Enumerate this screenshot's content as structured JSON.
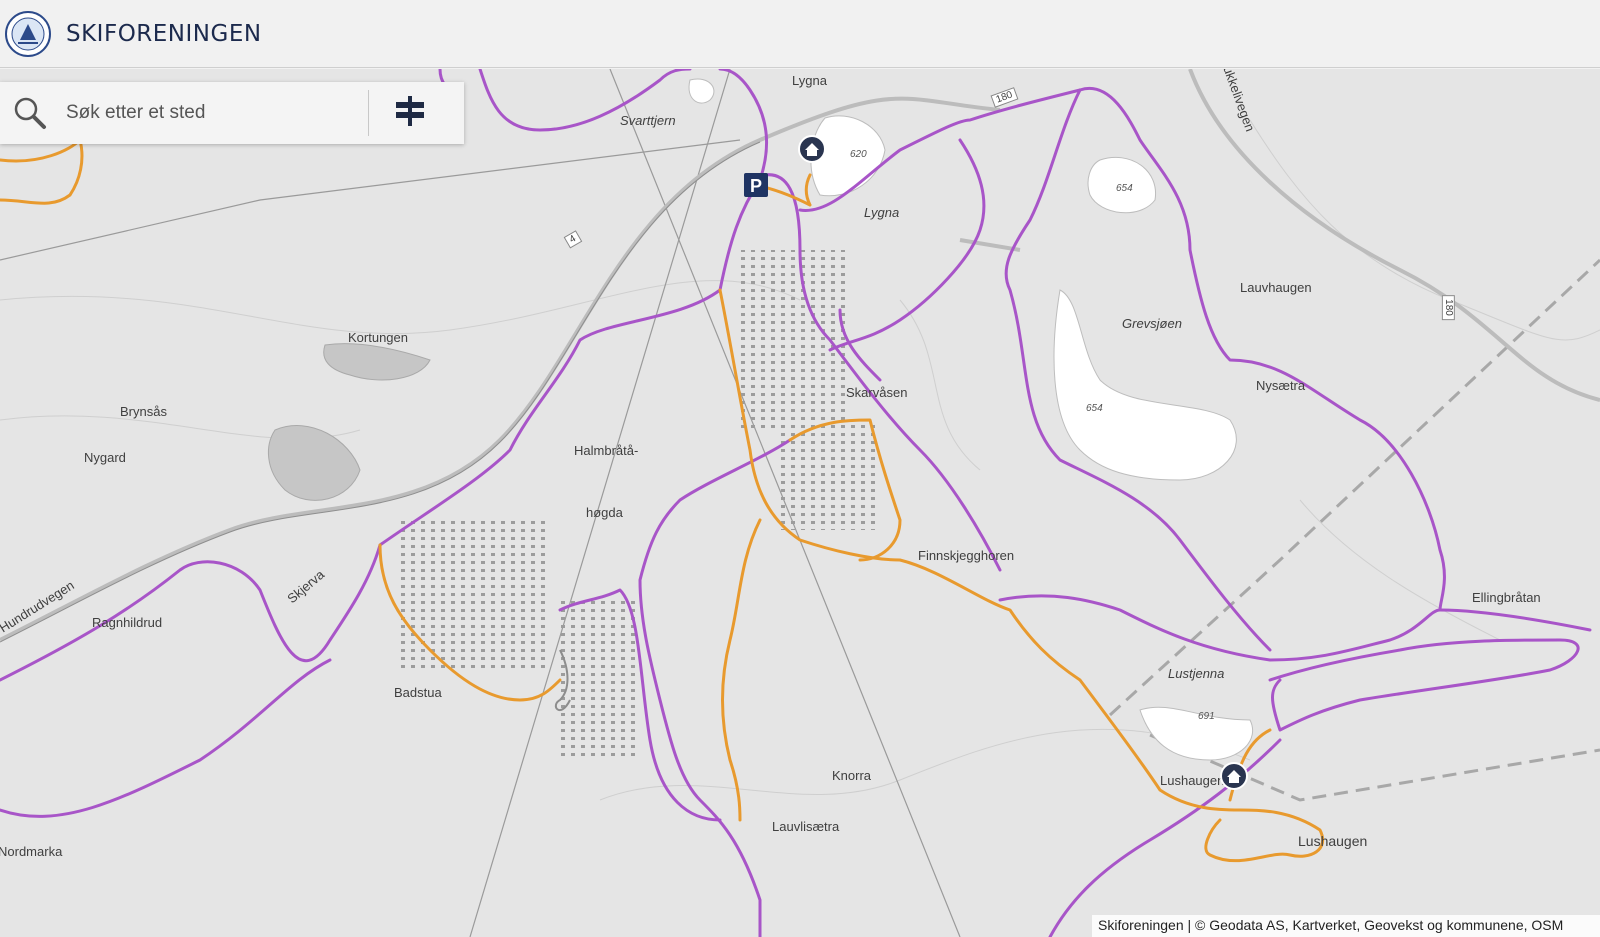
{
  "header": {
    "brand": "SKIFORENINGEN",
    "logo_icon": "skiforeningen-logo-icon"
  },
  "search": {
    "placeholder": "Søk etter et sted",
    "value": "",
    "search_icon": "magnifier-icon",
    "filter_icon": "signpost-icon"
  },
  "map": {
    "trail_colors": {
      "purple": "#a855c8",
      "orange": "#e89a2e"
    },
    "places": {
      "lygna_n": "Lygna",
      "svarttjern": "Svarttjern",
      "lygna": "Lygna",
      "lake_620": "620",
      "lake_654": "654",
      "kortungen": "Kortungen",
      "brynsas": "Brynsås",
      "nygard": "Nygard",
      "halmbrata1": "Halmbråtå-",
      "halmbrata2": "høgda",
      "skarvasen": "Skarvåsen",
      "grevsjoen": "Grevsjøen",
      "lake_654b": "654",
      "lauvhaugen": "Lauvhaugen",
      "nysatra": "Nysætra",
      "finnskjegghoren": "Finnskjegghoren",
      "ellingbratan": "Ellingbråtan",
      "lustjenna": "Lustjenna",
      "lake_691": "691",
      "lushaugen1": "Lushaugen",
      "lushaugen2": "Lushaugen",
      "knorra": "Knorra",
      "lauvlisatra": "Lauvlisætra",
      "badstua": "Badstua",
      "ragnhildrud": "Ragnhildrud",
      "skjerva": "Skjerva",
      "road_left": "Hundrudvegen",
      "bruvegen": "Brukkelivegen",
      "nordmarka": "Nordmarka",
      "road_180a": "180",
      "road_180b": "180",
      "road_4": "4"
    },
    "markers": {
      "parking_label": "P",
      "parking_icon": "parking-icon",
      "cabin_icon": "cabin-icon"
    }
  },
  "attribution": "Skiforeningen | © Geodata AS, Kartverket, Geovekst og kommunene, OSM"
}
